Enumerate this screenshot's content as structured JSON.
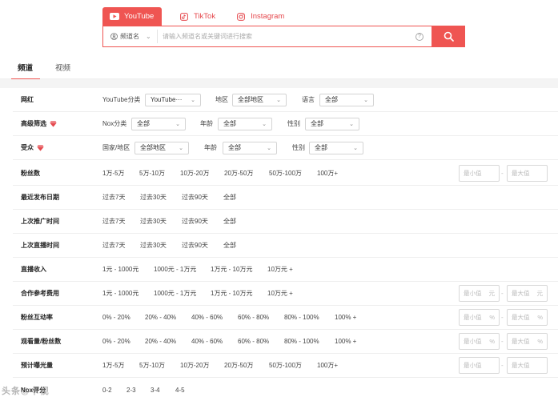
{
  "platforms": [
    {
      "label": "YouTube"
    },
    {
      "label": "TikTok"
    },
    {
      "label": "Instagram"
    }
  ],
  "search": {
    "type_select": "频道名",
    "placeholder": "请输入频道名或关键词进行搜索",
    "help": "?"
  },
  "section_tabs": {
    "channels": "频道",
    "videos": "视频"
  },
  "filters": {
    "wanghong": {
      "label": "网红",
      "category_label": "YouTube分类",
      "category_value": "YouTube···",
      "region_label": "地区",
      "region_value": "全部地区",
      "language_label": "语言",
      "language_value": "全部"
    },
    "advanced": {
      "label": "高级筛选",
      "nox_label": "Nox分类",
      "nox_value": "全部",
      "age_label": "年龄",
      "age_value": "全部",
      "gender_label": "性别",
      "gender_value": "全部"
    },
    "audience": {
      "label": "受众",
      "country_label": "国家/地区",
      "country_value": "全部地区",
      "age_label": "年龄",
      "age_value": "全部",
      "gender_label": "性别",
      "gender_value": "全部"
    },
    "followers": {
      "label": "粉丝数",
      "options": [
        "1万-5万",
        "5万-10万",
        "10万-20万",
        "20万-50万",
        "50万-100万",
        "100万+"
      ],
      "min": "最小值",
      "max": "最大值"
    },
    "last_publish": {
      "label": "最近发布日期",
      "options": [
        "过去7天",
        "过去30天",
        "过去90天",
        "全部"
      ]
    },
    "last_promo": {
      "label": "上次推广时间",
      "options": [
        "过去7天",
        "过去30天",
        "过去90天",
        "全部"
      ]
    },
    "last_live": {
      "label": "上次直播时间",
      "options": [
        "过去7天",
        "过去30天",
        "过去90天",
        "全部"
      ]
    },
    "live_income": {
      "label": "直播收入",
      "options": [
        "1元 - 1000元",
        "1000元 - 1万元",
        "1万元 - 10万元",
        "10万元 +"
      ]
    },
    "coop_fee": {
      "label": "合作参考费用",
      "options": [
        "1元 - 1000元",
        "1000元 - 1万元",
        "1万元 - 10万元",
        "10万元 +"
      ],
      "min": "最小值",
      "max": "最大值",
      "unit": "元"
    },
    "engagement": {
      "label": "粉丝互动率",
      "options": [
        "0% - 20%",
        "20% - 40%",
        "40% - 60%",
        "60% - 80%",
        "80% - 100%",
        "100% +"
      ],
      "min": "最小值",
      "max": "最大值",
      "unit": "%"
    },
    "view_ratio": {
      "label": "观看量/粉丝数",
      "options": [
        "0% - 20%",
        "20% - 40%",
        "40% - 60%",
        "60% - 80%",
        "80% - 100%",
        "100% +"
      ],
      "min": "最小值",
      "max": "最大值",
      "unit": "%"
    },
    "exposure": {
      "label": "预计曝光量",
      "options": [
        "1万-5万",
        "5万-10万",
        "10万-20万",
        "20万-50万",
        "50万-100万",
        "100万+"
      ],
      "min": "最小值",
      "max": "最大值"
    },
    "nox_score": {
      "label": "Nox评分",
      "options": [
        "0-2",
        "2-3",
        "3-4",
        "4-5"
      ]
    }
  },
  "watermark": "头条@卡视",
  "colors": {
    "accent": "#ef5552",
    "gem": "#e5484d"
  }
}
